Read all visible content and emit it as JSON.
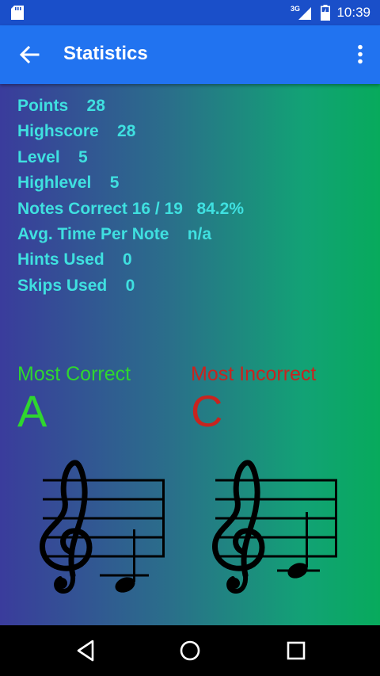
{
  "status_bar": {
    "network": "3G",
    "time": "10:39"
  },
  "app_bar": {
    "title": "Statistics",
    "icons": [
      "back-arrow-icon",
      "overflow-menu-icon"
    ]
  },
  "stats": [
    {
      "label": "Points",
      "value": "28",
      "gap": "    "
    },
    {
      "label": "Highscore",
      "value": "28",
      "gap": "    "
    },
    {
      "label": "Level",
      "value": "5",
      "gap": "    "
    },
    {
      "label": "Highlevel",
      "value": "5",
      "gap": "    "
    },
    {
      "label": "Notes Correct",
      "value": "16 / 19   84.2%",
      "gap": " "
    },
    {
      "label": "Avg. Time Per Note",
      "value": "n/a",
      "gap": "    "
    },
    {
      "label": "Hints Used",
      "value": "0",
      "gap": "    "
    },
    {
      "label": "Skips Used",
      "value": "0",
      "gap": "    "
    }
  ],
  "most_correct": {
    "label": "Most Correct",
    "note": "A"
  },
  "most_incorrect": {
    "label": "Most Incorrect",
    "note": "C"
  },
  "colors": {
    "app_bar": "#2173f0",
    "status_bar": "#1a4fc9",
    "stat_text": "#3fe0e0",
    "correct": "#2fd62f",
    "incorrect": "#c8241f"
  },
  "nav_bar": {
    "icons": [
      "back-triangle-icon",
      "home-circle-icon",
      "recents-square-icon"
    ]
  }
}
